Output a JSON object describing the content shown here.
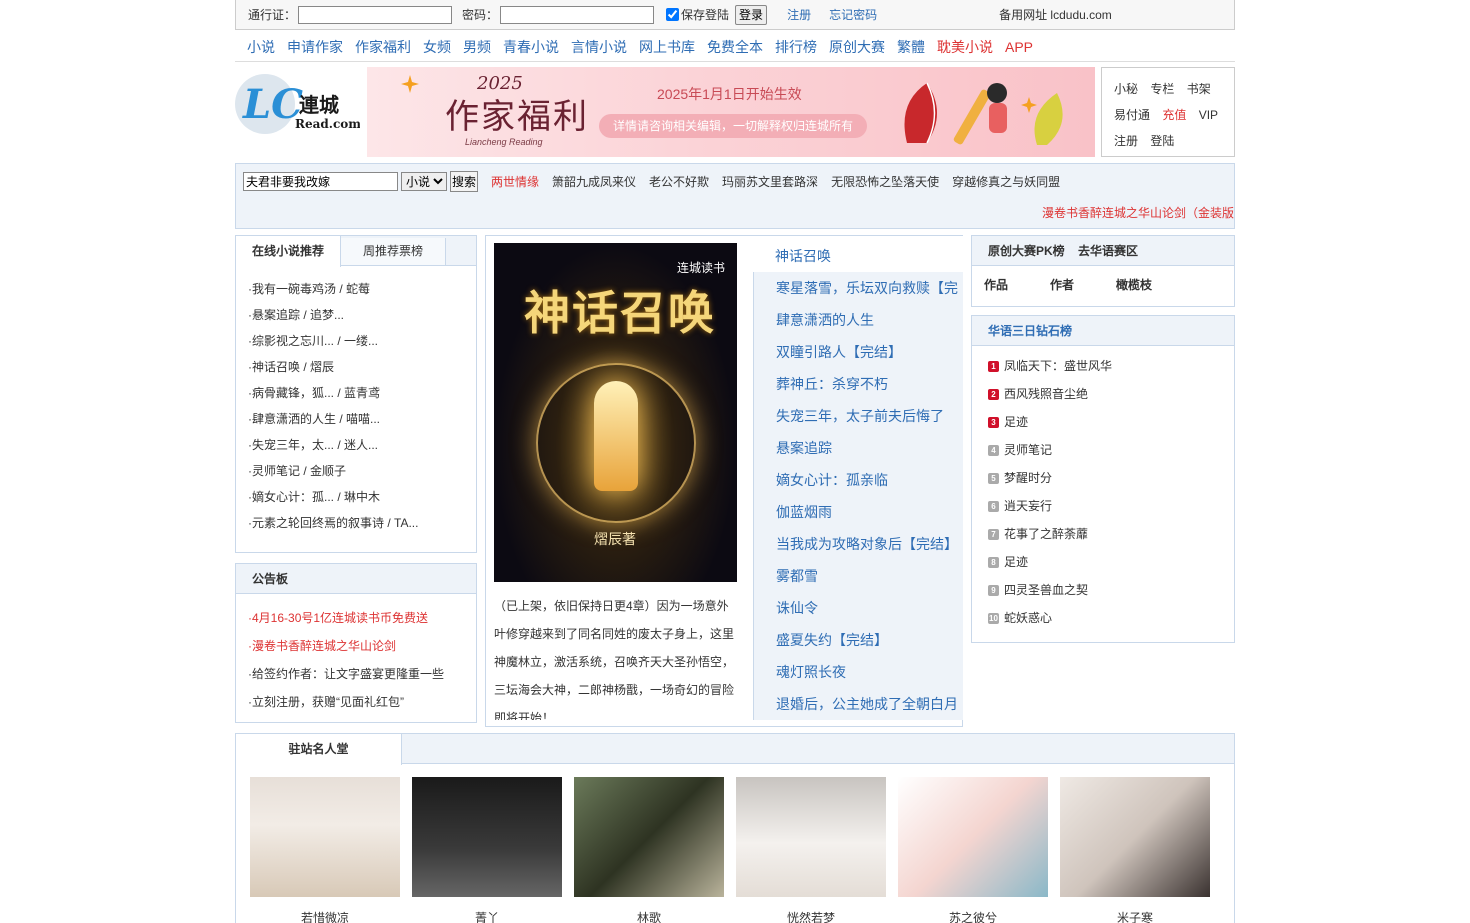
{
  "login": {
    "account_label": "通行证：",
    "password_label": "密码：",
    "remember_label": "保存登陆",
    "login_button": "登录",
    "register_link": "注册",
    "forgot_link": "忘记密码",
    "alt_site": "备用网址 lcdudu.com"
  },
  "nav": [
    {
      "label": "小说",
      "color": "#2f6db4"
    },
    {
      "label": "申请作家",
      "color": "#2f6db4"
    },
    {
      "label": "作家福利",
      "color": "#2f6db4"
    },
    {
      "label": "女频",
      "color": "#2f6db4"
    },
    {
      "label": "男频",
      "color": "#2f6db4"
    },
    {
      "label": "青春小说",
      "color": "#2f6db4"
    },
    {
      "label": "言情小说",
      "color": "#2f6db4"
    },
    {
      "label": "网上书库",
      "color": "#2f6db4"
    },
    {
      "label": "免费全本",
      "color": "#2f6db4"
    },
    {
      "label": "排行榜",
      "color": "#2f6db4"
    },
    {
      "label": "原创大赛",
      "color": "#2f6db4"
    },
    {
      "label": "繁體",
      "color": "#2f6db4"
    },
    {
      "label": "耽美小说",
      "color": "#dd3333"
    },
    {
      "label": "APP",
      "color": "#dd3333"
    }
  ],
  "logo": {
    "text": "連城",
    "sub": "Read.com",
    "mark": "LC"
  },
  "banner": {
    "year": "2025",
    "title": "作家福利",
    "subtitle": "Liancheng Reading",
    "date": "2025年1月1日开始生效",
    "note": "详情请咨询相关编辑，一切解释权归连城所有"
  },
  "usermenu": {
    "row1": [
      "小秘",
      "专栏",
      "书架"
    ],
    "row2": [
      "易付通",
      "充值",
      "VIP"
    ],
    "row3": [
      "注册",
      "登陆"
    ]
  },
  "search": {
    "value": "夫君非要我改嫁",
    "category": "小说",
    "button": "搜索",
    "hot": [
      "两世情缘",
      "箫韶九成凤来仪",
      "老公不好欺",
      "玛丽苏文里套路深",
      "无限恐怖之坠落天使",
      "穿越修真之与妖同盟"
    ],
    "marquee": "漫卷书香醉连城之华山论剑（金装版"
  },
  "recommend": {
    "tab_active": "在线小说推荐",
    "tab_inactive": "周推荐票榜",
    "items": [
      "·我有一碗毒鸡汤 / 蛇莓",
      "·悬案追踪 / 追梦...",
      "·综影视之忘川... / 一缕...",
      "·神话召唤 / 熠辰",
      "·病骨藏锋，狐... / 蓝青鸢",
      "·肆意潇洒的人生 / 喵喵...",
      "·失宠三年，太... / 迷人...",
      "·灵师笔记 / 金顺子",
      "·嫡女心计：孤... / 琳中木",
      "·元素之轮回终焉的叙事诗 / TA..."
    ]
  },
  "notice": {
    "title": "公告板",
    "items": [
      {
        "text": "·4月16-30号1亿连城读书币免费送",
        "red": true
      },
      {
        "text": "·漫卷书香醉连城之华山论剑",
        "red": true
      },
      {
        "text": "·给签约作者：让文字盛宴更隆重一些",
        "red": false
      },
      {
        "text": "·立刻注册，获赠“见面礼红包”",
        "red": false
      }
    ]
  },
  "featured": {
    "cover_title": "神话召唤",
    "cover_brand": "连城读书",
    "cover_author": "熠辰著",
    "intro": "（已上架，依旧保持日更4章）因为一场意外叶修穿越来到了同名同姓的废太子身上，这里神魔林立，激活系统，召唤齐天大圣孙悟空，三坛海会大神，二郎神杨戬，一场奇幻的冒险即将开始！",
    "list": [
      "神话召唤",
      "寒星落雪，乐坛双向救赎【完",
      "肆意潇洒的人生",
      "双瞳引路人【完结】",
      "葬神丘：杀穿不朽",
      "失宠三年，太子前夫后悔了",
      "悬案追踪",
      "嫡女心计：孤亲临",
      "伽蓝烟雨",
      "当我成为攻略对象后【完结】",
      "雾都雪",
      "诛仙令",
      "盛夏失约【完结】",
      "魂灯照长夜",
      "退婚后，公主她成了全朝白月"
    ]
  },
  "pk": {
    "title": "原创大赛PK榜",
    "link": "去华语赛区",
    "cols": [
      "作品",
      "作者",
      "橄榄枝"
    ]
  },
  "diamond": {
    "title": "华语三日钻石榜",
    "items": [
      "凤临天下：盛世风华",
      "西风残照音尘绝",
      "足迹",
      "灵师笔记",
      "梦醒时分",
      "逍天妄行",
      "花事了之醉荼蘼",
      "足迹",
      "四灵圣兽血之契",
      "蛇妖惑心"
    ]
  },
  "hall": {
    "title": "驻站名人堂",
    "people": [
      "若惜微凉",
      "菁丫",
      "林歌",
      "恍然若梦",
      "苏之彼兮",
      "米子寒"
    ]
  }
}
